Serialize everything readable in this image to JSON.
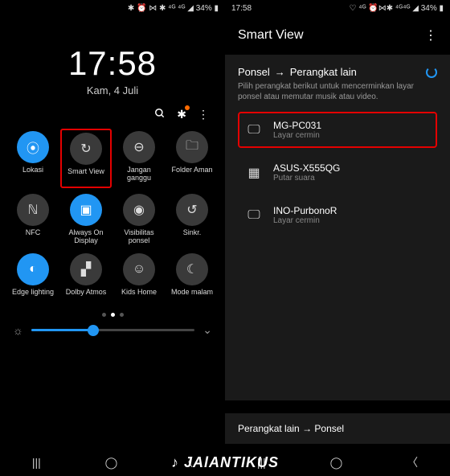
{
  "left": {
    "status": {
      "icons": "✱ ⏰ ⋈ ✱ ⁴ᴳ ⁴ᴳ ◢ 34% ▮"
    },
    "clock": "17:58",
    "date": "Kam, 4 Juli",
    "actions": {
      "search": "⚲",
      "settings": "✱",
      "menu": "⋮"
    },
    "tiles": [
      {
        "icon": "⦿",
        "label": "Lokasi",
        "on": true
      },
      {
        "icon": "↻",
        "label": "Smart View",
        "on": false,
        "hl": true
      },
      {
        "icon": "⊖",
        "label": "Jangan ganggu",
        "on": false
      },
      {
        "icon": "🗀",
        "label": "Folder Aman",
        "on": false
      },
      {
        "icon": "ℕ",
        "label": "NFC",
        "on": false
      },
      {
        "icon": "▣",
        "label": "Always On Display",
        "on": true
      },
      {
        "icon": "◉",
        "label": "Visibilitas ponsel",
        "on": false
      },
      {
        "icon": "↺",
        "label": "Sinkr.",
        "on": false
      },
      {
        "icon": "◐",
        "label": "Edge lighting",
        "on": true
      },
      {
        "icon": "▞",
        "label": "Dolby Atmos",
        "on": false
      },
      {
        "icon": "☺",
        "label": "Kids Home",
        "on": false
      },
      {
        "icon": "☾",
        "label": "Mode malam",
        "on": false
      }
    ]
  },
  "right": {
    "status": {
      "time": "17:58",
      "icons": "♡ ⁴ᴳ   ⏰⋈✱ ⁴ᴳ⁴ᴳ ◢ 34% ▮"
    },
    "title": "Smart View",
    "section_title_a": "Ponsel",
    "section_title_b": "Perangkat lain",
    "section_sub": "Pilih perangkat berikut untuk mencerminkan layar ponsel atau memutar musik atau video.",
    "devices": [
      {
        "icon": "🖵",
        "name": "MG-PC031",
        "sub": "Layar cermin",
        "hl": true
      },
      {
        "icon": "▦",
        "name": "ASUS-X555QG",
        "sub": "Putar suara"
      },
      {
        "icon": "🖵",
        "name": "INO-PurbonoR",
        "sub": "Layar cermin"
      }
    ],
    "bottom_a": "Perangkat lain",
    "bottom_b": "Ponsel"
  },
  "watermark": "JAlANTIKUS"
}
